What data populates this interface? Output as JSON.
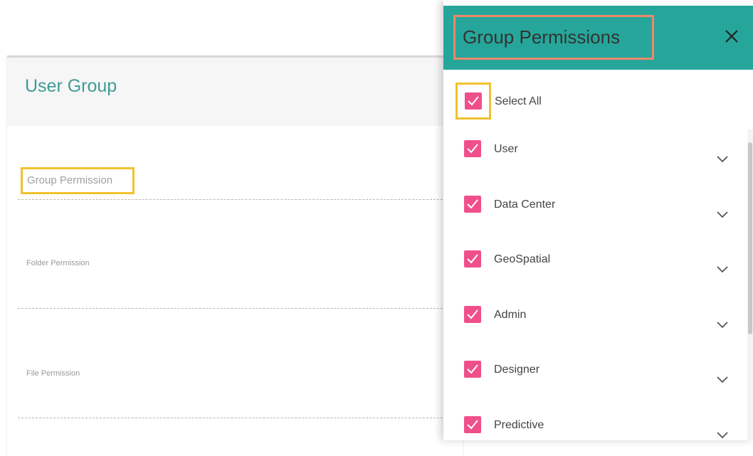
{
  "form": {
    "title": "User Group",
    "fields": [
      {
        "label": "Group Permission"
      },
      {
        "label": "Folder Permission"
      },
      {
        "label": "File Permission"
      }
    ]
  },
  "panel": {
    "title": "Group Permissions",
    "close_icon": "close-icon",
    "select_all": {
      "label": "Select All",
      "checked": true
    },
    "items": [
      {
        "label": "User",
        "checked": true
      },
      {
        "label": "Data Center",
        "checked": true
      },
      {
        "label": "GeoSpatial",
        "checked": true
      },
      {
        "label": "Admin",
        "checked": true
      },
      {
        "label": "Designer",
        "checked": true
      },
      {
        "label": "Predictive",
        "checked": true
      }
    ]
  },
  "colors": {
    "header_teal": "#26a69a",
    "title_teal": "#3f9b97",
    "checkbox_pink": "#f0508a",
    "highlight_yellow": "#f2c12e",
    "highlight_orange": "#f0886a"
  }
}
